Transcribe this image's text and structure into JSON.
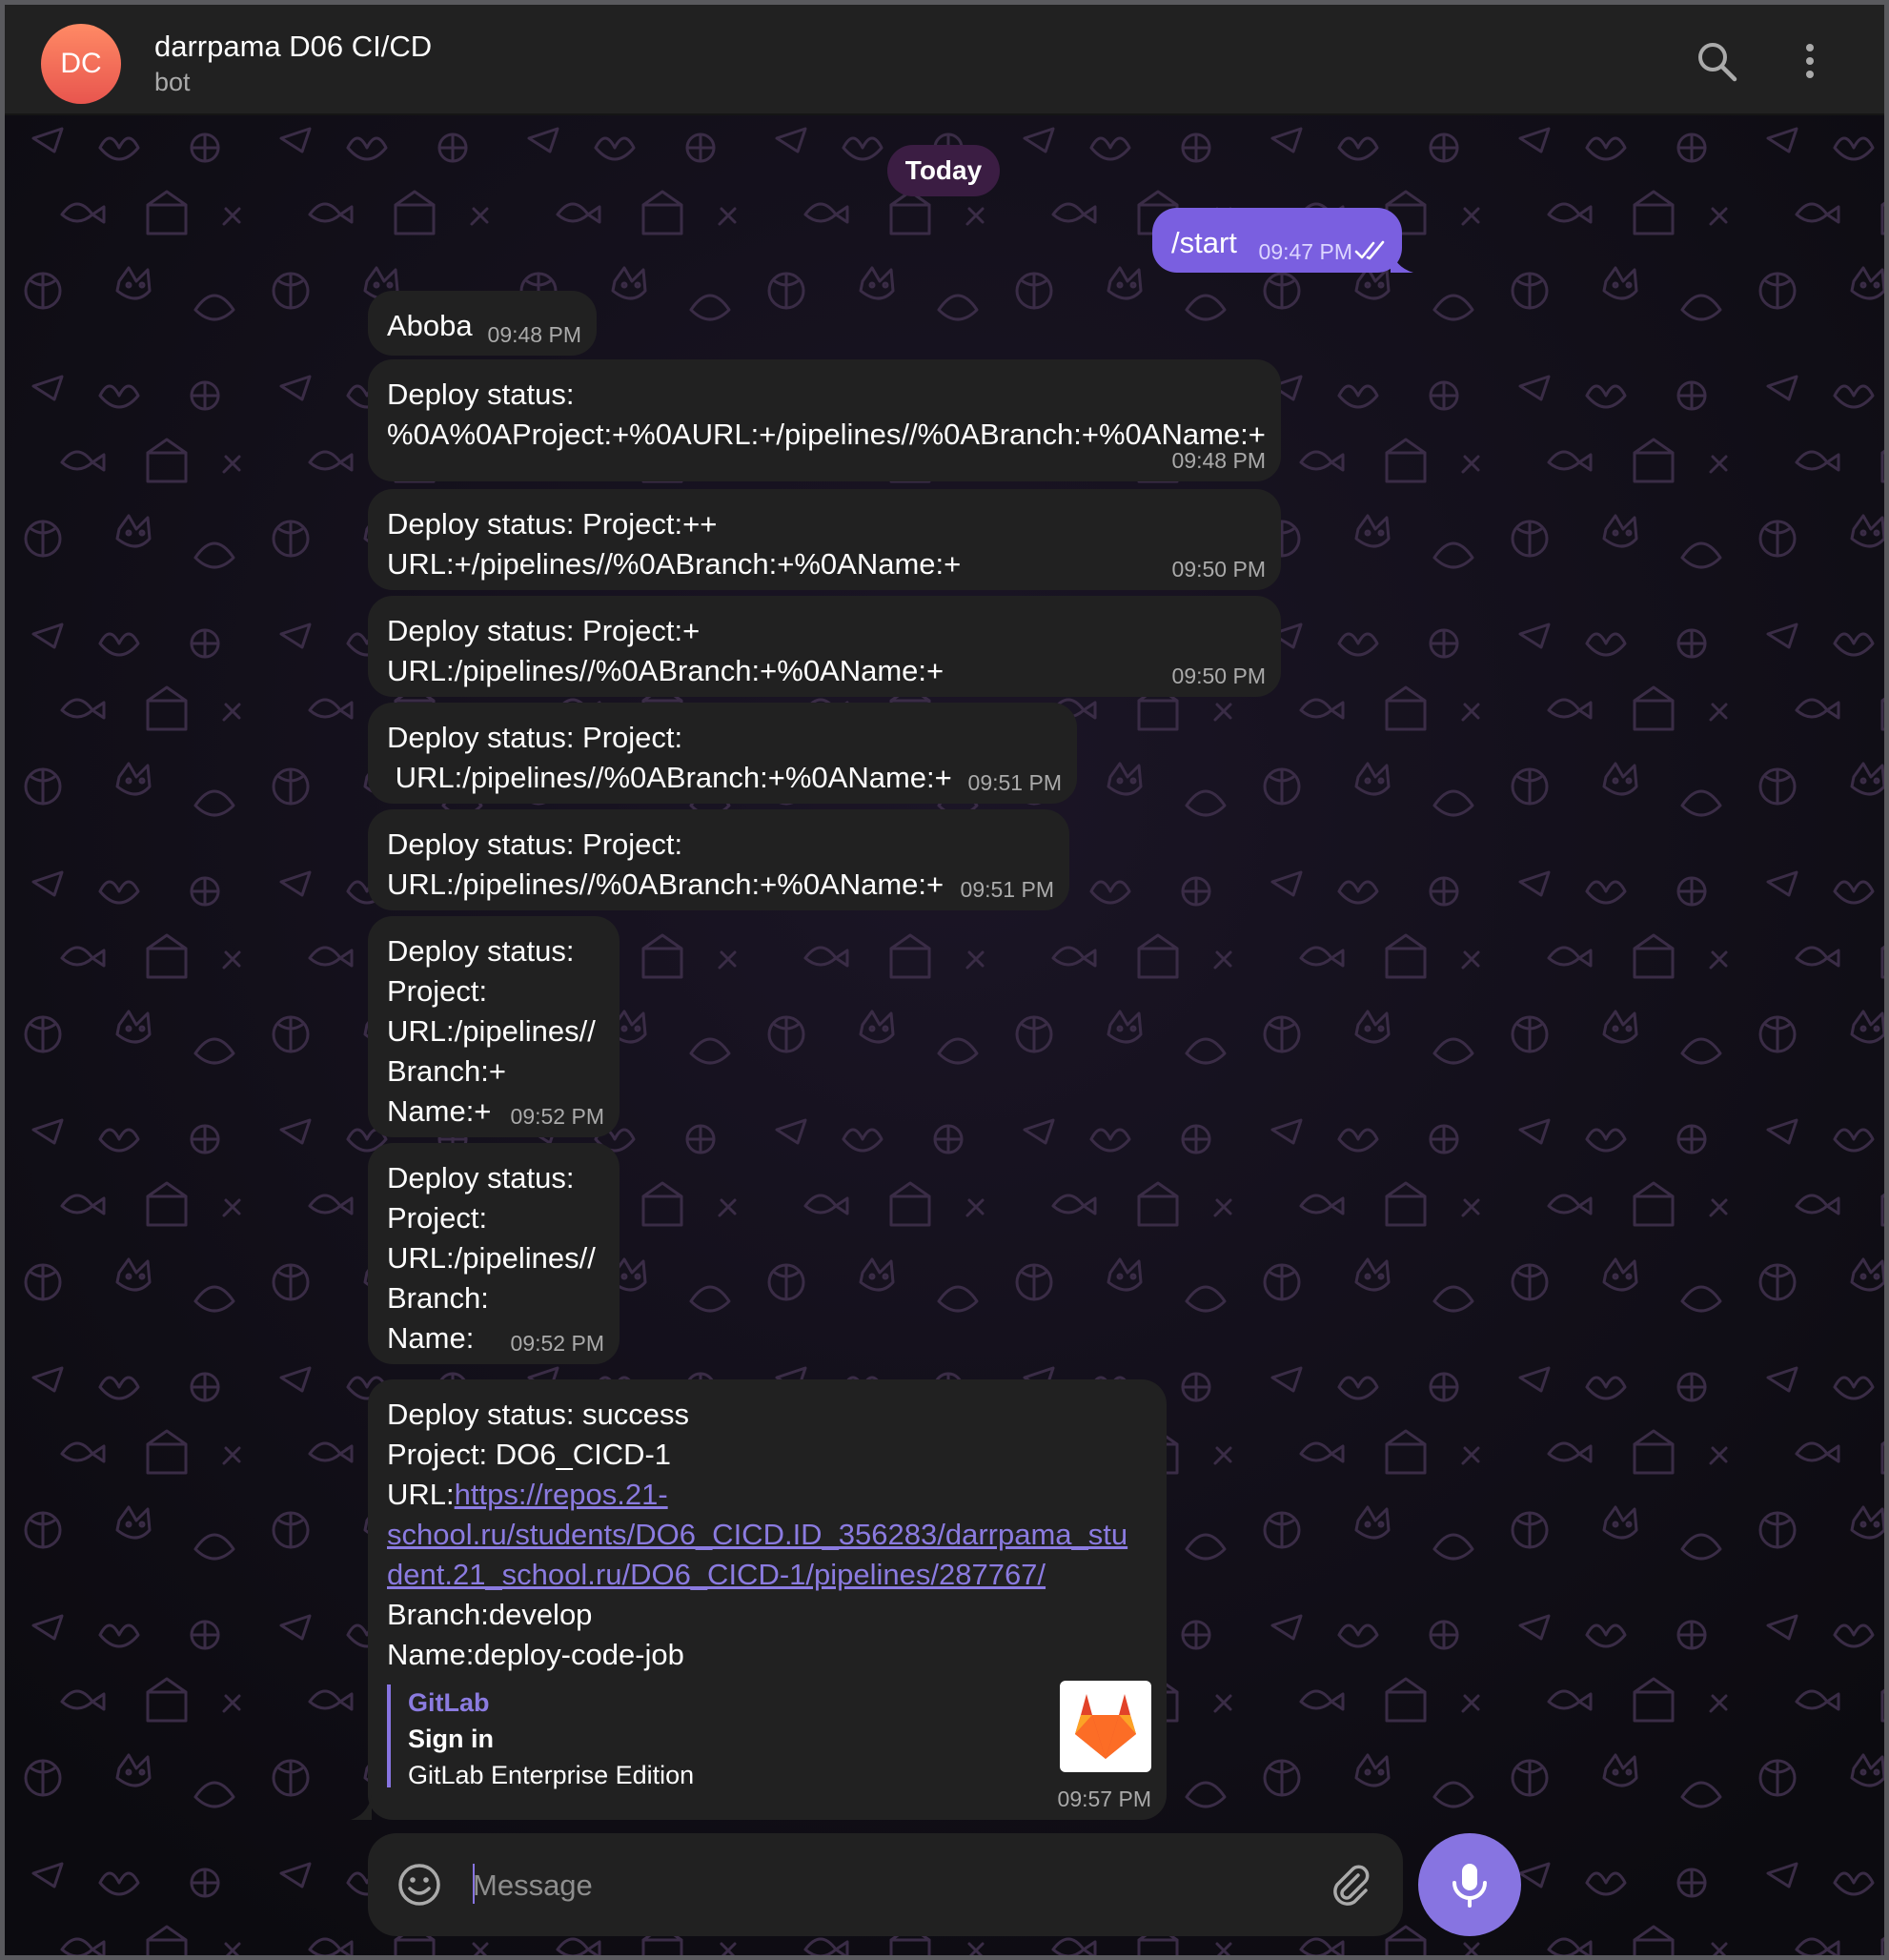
{
  "header": {
    "avatar_initials": "DC",
    "title": "darrpama D06 CI/CD",
    "subtitle": "bot",
    "search_icon": "search-icon",
    "menu_icon": "more-vertical-icon"
  },
  "date_separator": "Today",
  "messages": [
    {
      "dir": "out",
      "text": "/start",
      "time": "09:47 PM",
      "status": "read-double-check"
    },
    {
      "dir": "in",
      "text": "Aboba",
      "time": "09:48 PM"
    },
    {
      "dir": "in",
      "lines": [
        "Deploy status:",
        "%0A%0AProject:+%0AURL:+/pipelines//%0ABranch:+%0AName:+"
      ],
      "time": "09:48 PM"
    },
    {
      "dir": "in",
      "lines": [
        "Deploy status: Project:++",
        "URL:+/pipelines//%0ABranch:+%0AName:+"
      ],
      "time": "09:50 PM"
    },
    {
      "dir": "in",
      "lines": [
        "Deploy status: Project:+",
        "URL:/pipelines//%0ABranch:+%0AName:+"
      ],
      "time": "09:50 PM"
    },
    {
      "dir": "in",
      "lines": [
        "Deploy status: Project:",
        " URL:/pipelines//%0ABranch:+%0AName:+"
      ],
      "time": "09:51 PM"
    },
    {
      "dir": "in",
      "lines": [
        "Deploy status: Project:",
        "URL:/pipelines//%0ABranch:+%0AName:+"
      ],
      "time": "09:51 PM"
    },
    {
      "dir": "in",
      "lines": [
        "Deploy status:",
        "Project:",
        "URL:/pipelines//",
        "Branch:+",
        "Name:+"
      ],
      "time": "09:52 PM"
    },
    {
      "dir": "in",
      "lines": [
        "Deploy status:",
        "Project:",
        "URL:/pipelines//",
        "Branch:",
        "Name:"
      ],
      "time": "09:52 PM"
    },
    {
      "dir": "in",
      "line1": "Deploy status: success",
      "line2": "Project: DO6_CICD-1",
      "url_prefix": "URL:",
      "url_lines": [
        "https://repos.21-",
        "school.ru/students/DO6_CICD.ID_356283/darrpama_stu",
        "dent.21_school.ru/DO6_CICD-1/pipelines/287767/"
      ],
      "line_branch": "Branch:develop",
      "line_name": "Name:deploy-code-job",
      "preview": {
        "site": "GitLab",
        "title": "Sign in",
        "description": "GitLab Enterprise Edition",
        "thumb_icon": "gitlab-logo-icon"
      },
      "time": "09:57 PM"
    }
  ],
  "composer": {
    "placeholder": "Message",
    "emoji_icon": "emoji-icon",
    "attach_icon": "paperclip-icon",
    "mic_icon": "microphone-icon"
  },
  "colors": {
    "accent": "#8774e1",
    "bubble_in": "#212121",
    "bubble_out": "#7a5fe0",
    "date_chip": "#3b1d43",
    "link": "#8b7be0"
  }
}
